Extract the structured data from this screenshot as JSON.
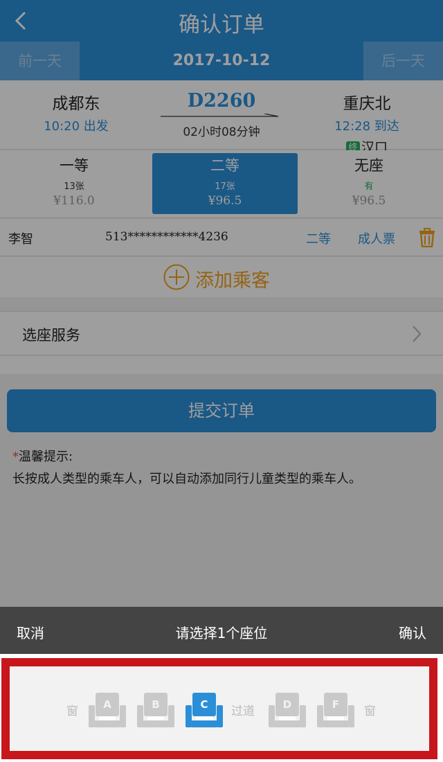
{
  "header": {
    "title": "确认订单"
  },
  "datebar": {
    "prev_day": "前一天",
    "date": "2017-10-12",
    "next_day": "后一天"
  },
  "train": {
    "number": "D2260",
    "duration": "02小时08分钟",
    "from": {
      "station": "成都东",
      "time": "10:20 出发"
    },
    "to": {
      "station": "重庆北",
      "time": "12:28 到达"
    },
    "terminus": {
      "badge": "终",
      "station": "汉口"
    }
  },
  "seat_classes": [
    {
      "name": "一等",
      "count": "13张",
      "price": "¥116.0"
    },
    {
      "name": "二等",
      "count": "17张",
      "price": "¥96.5"
    },
    {
      "name": "无座",
      "count": "有",
      "price": "¥96.5"
    }
  ],
  "passenger": {
    "name": "李智",
    "id_number": "513************4236",
    "seat_class": "二等",
    "ticket_type": "成人票"
  },
  "add_passenger_label": "添加乘客",
  "seat_service_label": "选座服务",
  "submit_label": "提交订单",
  "tips": {
    "star": "*",
    "title": "温馨提示:",
    "body": "长按成人类型的乘车人，可以自动添加同行儿童类型的乘车人。"
  },
  "picker": {
    "cancel_label": "取消",
    "prompt": "请选择1个座位",
    "confirm_label": "确认",
    "window_label": "窗",
    "aisle_label": "过道",
    "seats": [
      {
        "letter": "A",
        "selected": false
      },
      {
        "letter": "B",
        "selected": false
      },
      {
        "letter": "C",
        "selected": true
      },
      {
        "letter": "D",
        "selected": false
      },
      {
        "letter": "F",
        "selected": false
      }
    ]
  },
  "colors": {
    "primary": "#2b8fd8",
    "accent_orange": "#f0a020",
    "highlight_red": "#c8161d",
    "seat_inactive": "#c9c9c9",
    "seat_selected": "#2b8fd8"
  },
  "icons": {
    "back": "chevron-left-icon",
    "trash": "trash-icon",
    "add": "plus-circle-icon",
    "chevron": "chevron-right-icon",
    "seat": "seat-icon"
  }
}
